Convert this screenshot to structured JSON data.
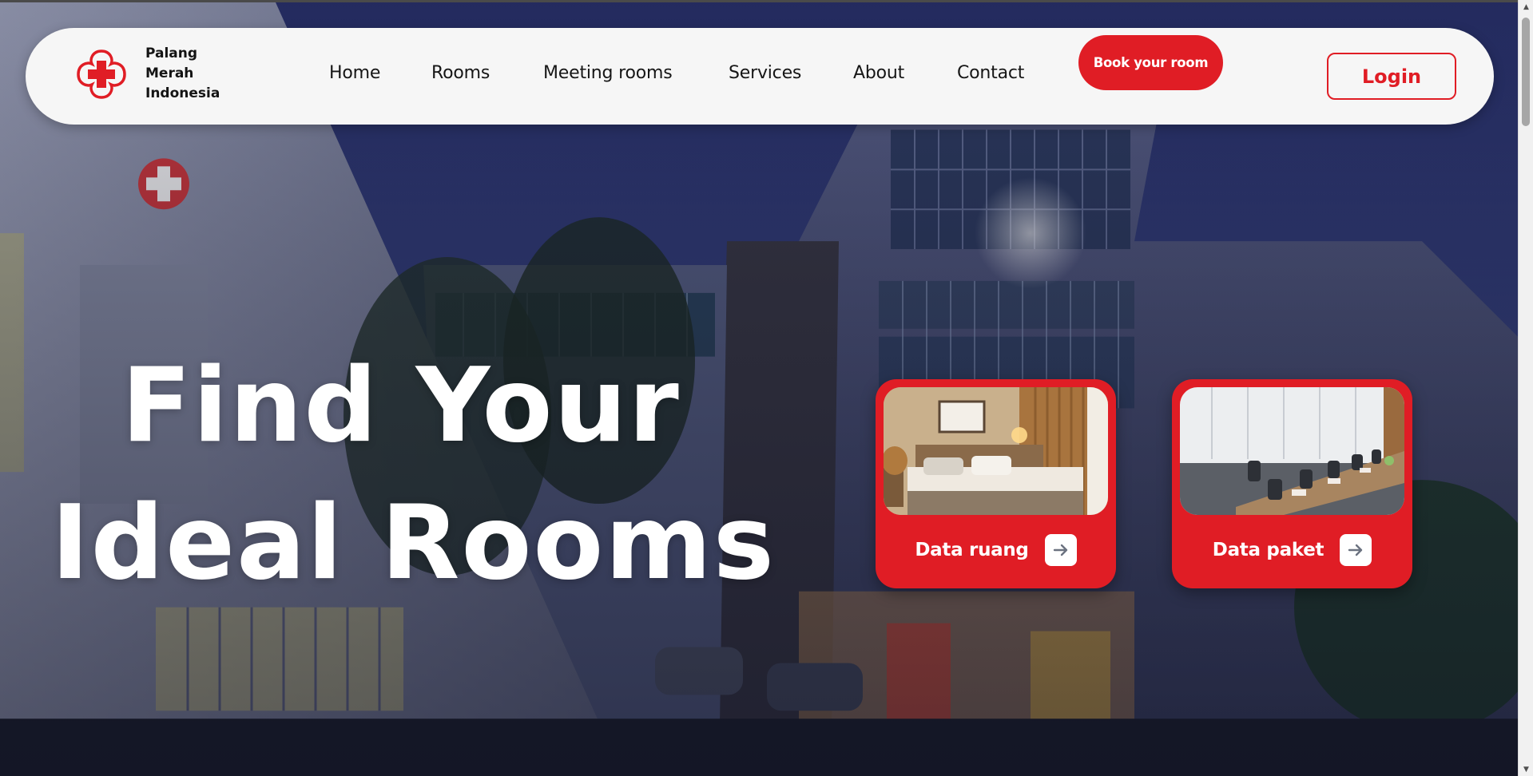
{
  "brand": {
    "name_line_1": "Palang",
    "name_line_2": "Merah",
    "name_line_3": "Indonesia",
    "logo_icon": "red-cross-flower-icon",
    "accent_color": "#e01d25"
  },
  "nav": {
    "items": [
      {
        "label": "Home"
      },
      {
        "label": "Rooms"
      },
      {
        "label": "Meeting rooms"
      },
      {
        "label": "Services"
      },
      {
        "label": "About"
      },
      {
        "label": "Contact"
      }
    ],
    "book_button": "Book your room",
    "login_button": "Login"
  },
  "hero": {
    "heading_line_1": "Find Your",
    "heading_line_2": "Ideal Rooms",
    "cards": [
      {
        "label": "Data ruang",
        "image": "bedroom-photo",
        "icon": "arrow-right-icon"
      },
      {
        "label": "Data paket",
        "image": "meeting-room-photo",
        "icon": "arrow-right-icon"
      }
    ]
  }
}
